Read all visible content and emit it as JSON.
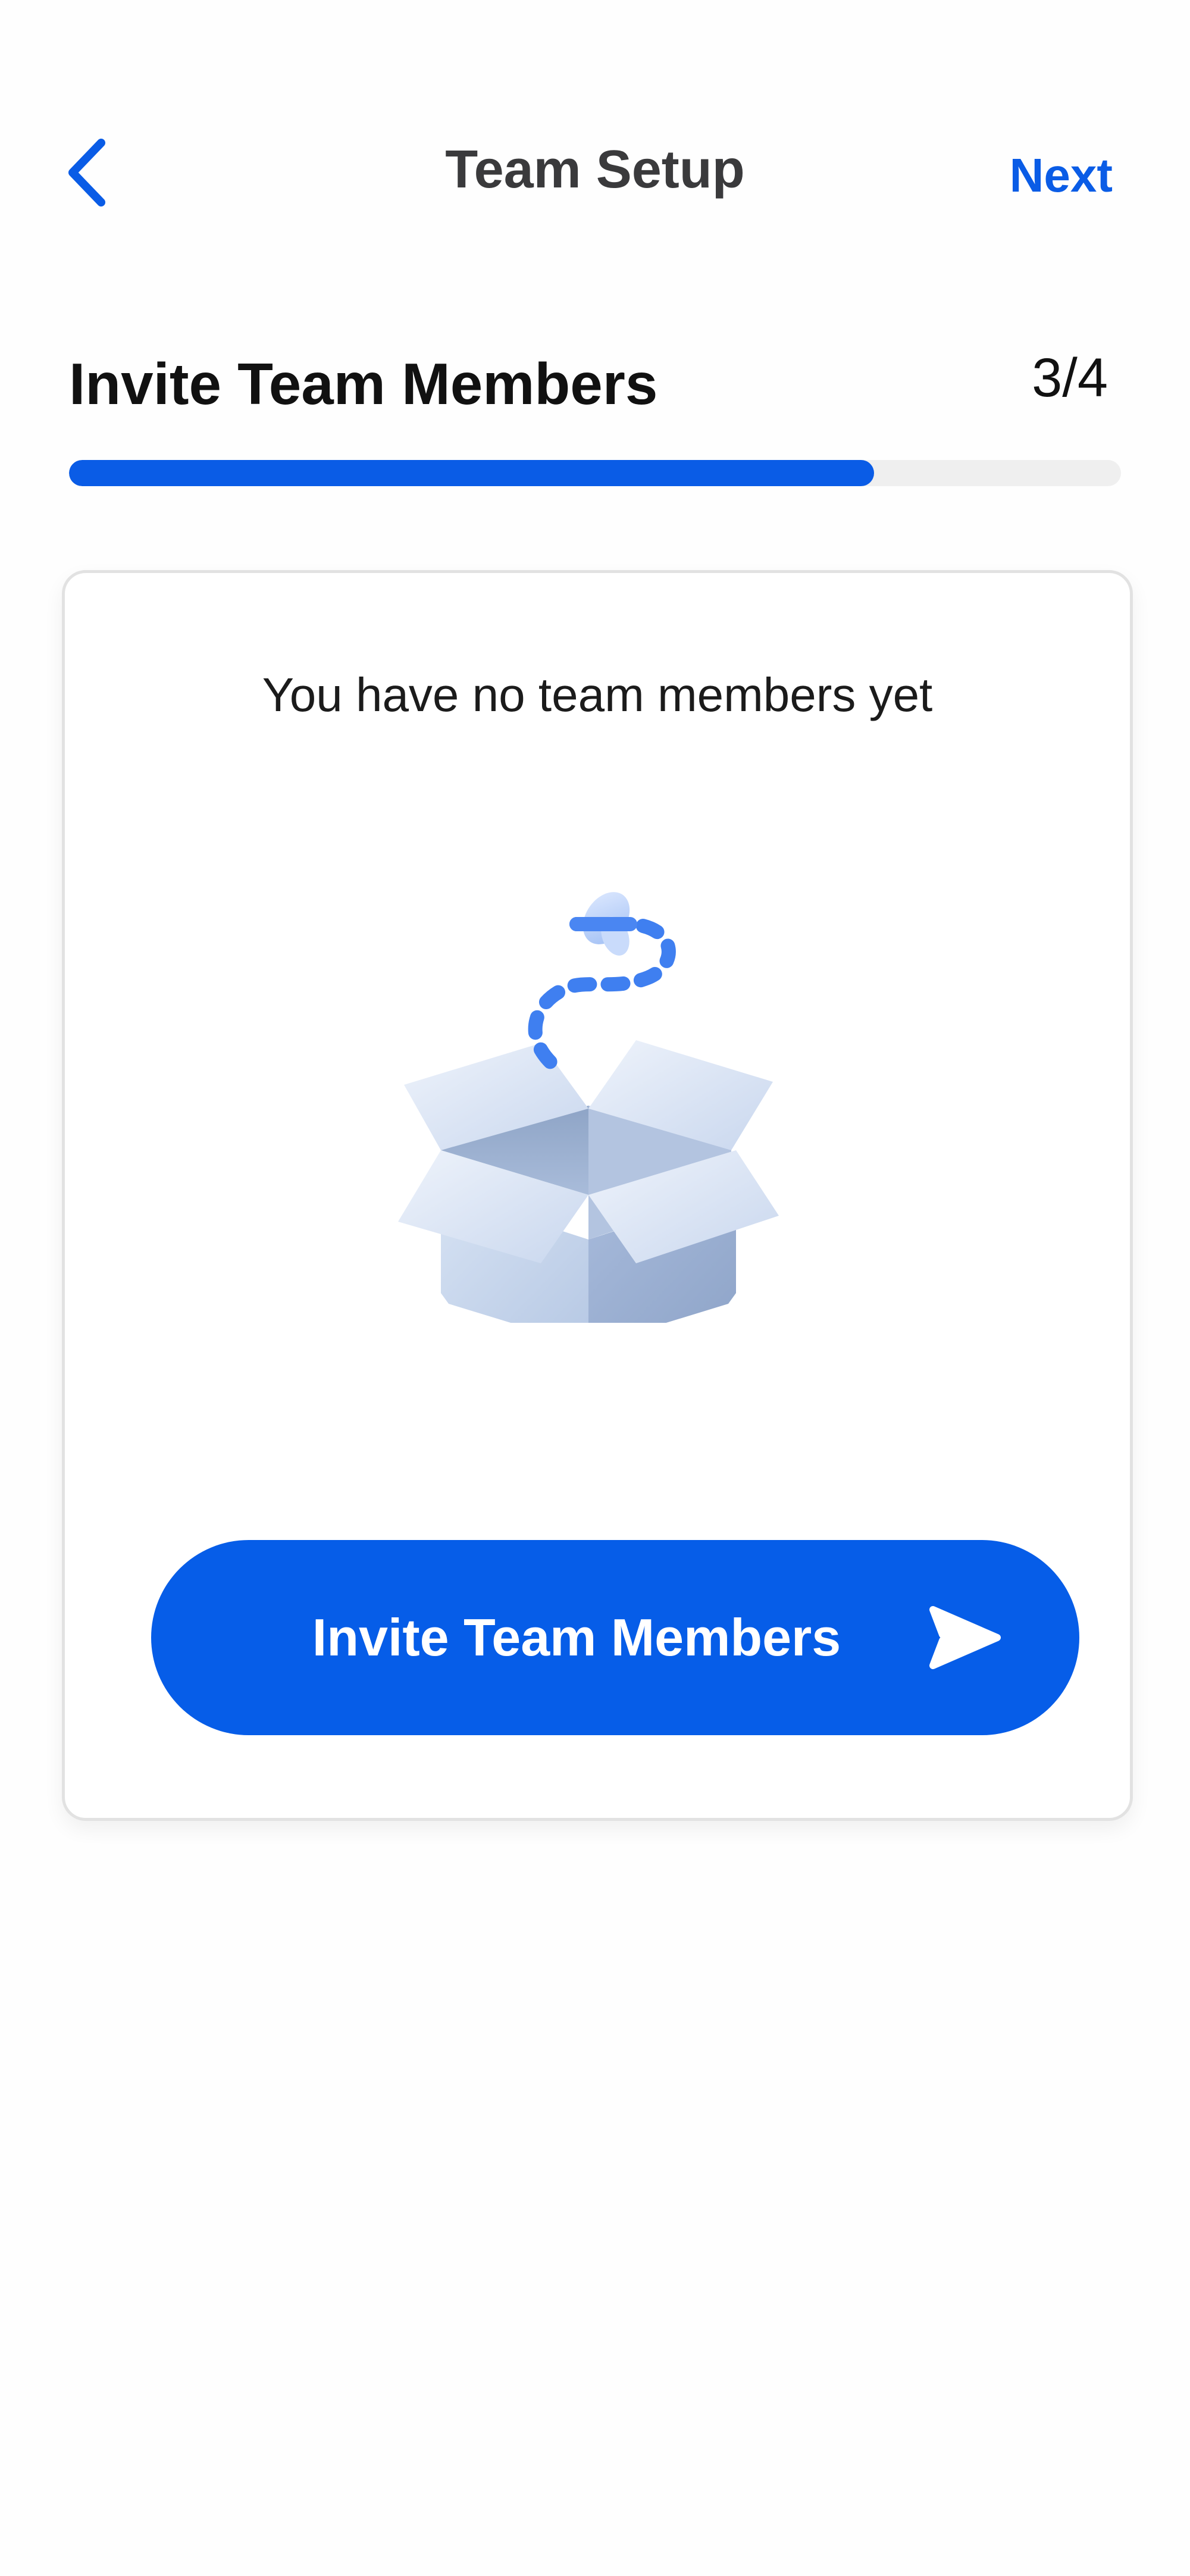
{
  "header": {
    "back_icon": "chevron-left-icon",
    "title": "Team Setup",
    "next_label": "Next"
  },
  "step": {
    "title": "Invite Team Members",
    "count": "3/4",
    "progress": 0.765
  },
  "card": {
    "empty_message": "You have no team members yet",
    "illustration": "open-box-with-dotted-path",
    "invite_button_label": "Invite Team Members",
    "invite_button_icon": "send-icon"
  },
  "colors": {
    "accent": "#0a5ce6",
    "button": "#065de8",
    "title": "#3a3a3c",
    "track": "#efefef"
  }
}
